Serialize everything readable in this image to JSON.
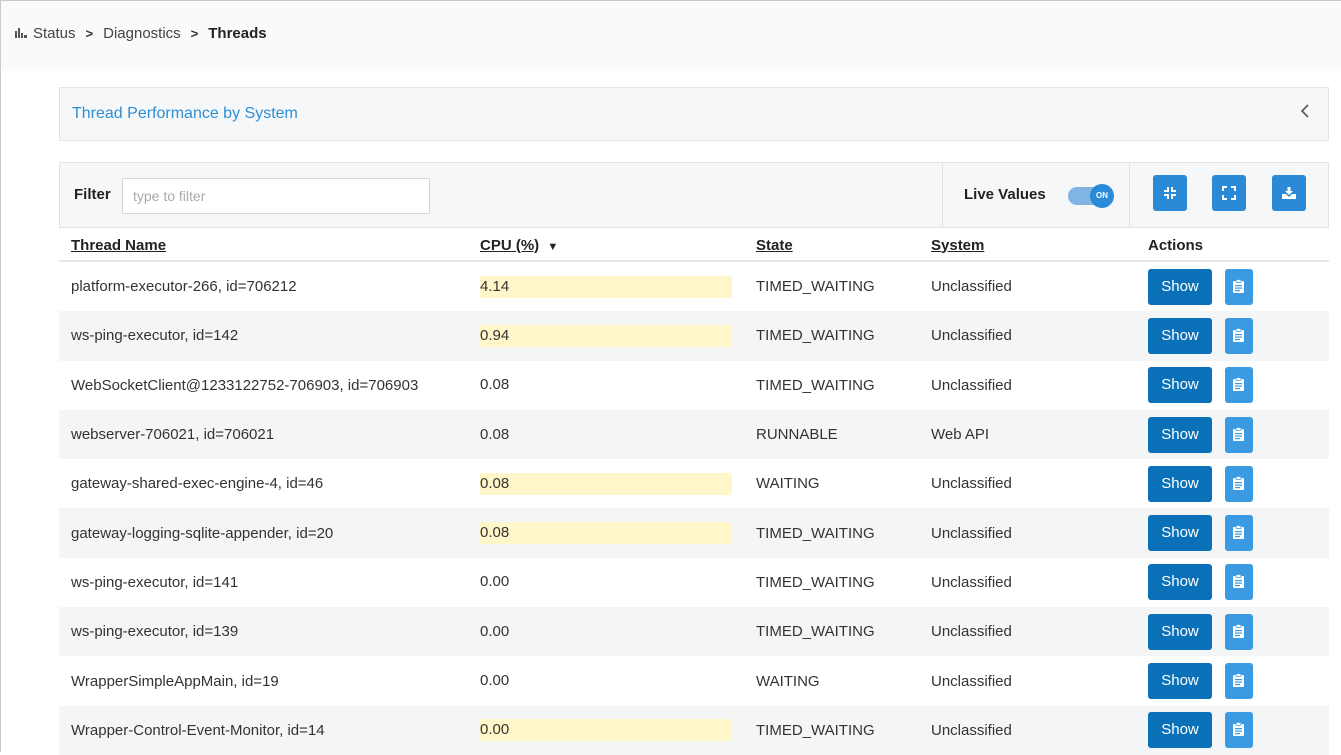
{
  "breadcrumb": {
    "items": [
      "Status",
      "Diagnostics"
    ],
    "current": "Threads",
    "separator": ">"
  },
  "panel": {
    "title": "Thread Performance by System",
    "collapse_icon": "chevron-left-icon"
  },
  "toolbar": {
    "filter_label": "Filter",
    "filter_placeholder": "type to filter",
    "filter_value": "",
    "live_values_label": "Live Values",
    "live_toggle_text": "ON",
    "live_values_on": true,
    "buttons": [
      "collapse-icon",
      "expand-icon",
      "download-icon"
    ]
  },
  "table": {
    "columns": {
      "thread_name": "Thread Name",
      "cpu": "CPU (%)",
      "state": "State",
      "system": "System",
      "actions": "Actions"
    },
    "sort_indicator": "▼",
    "show_label": "Show",
    "rows": [
      {
        "name": "platform-executor-266, id=706212",
        "cpu": "4.14",
        "highlight": true,
        "state": "TIMED_WAITING",
        "system": "Unclassified"
      },
      {
        "name": "ws-ping-executor, id=142",
        "cpu": "0.94",
        "highlight": true,
        "state": "TIMED_WAITING",
        "system": "Unclassified"
      },
      {
        "name": "WebSocketClient@1233122752-706903, id=706903",
        "cpu": "0.08",
        "highlight": false,
        "state": "TIMED_WAITING",
        "system": "Unclassified"
      },
      {
        "name": "webserver-706021, id=706021",
        "cpu": "0.08",
        "highlight": false,
        "state": "RUNNABLE",
        "system": "Web API"
      },
      {
        "name": "gateway-shared-exec-engine-4, id=46",
        "cpu": "0.08",
        "highlight": true,
        "state": "WAITING",
        "system": "Unclassified"
      },
      {
        "name": "gateway-logging-sqlite-appender, id=20",
        "cpu": "0.08",
        "highlight": true,
        "state": "TIMED_WAITING",
        "system": "Unclassified"
      },
      {
        "name": "ws-ping-executor, id=141",
        "cpu": "0.00",
        "highlight": false,
        "state": "TIMED_WAITING",
        "system": "Unclassified"
      },
      {
        "name": "ws-ping-executor, id=139",
        "cpu": "0.00",
        "highlight": false,
        "state": "TIMED_WAITING",
        "system": "Unclassified"
      },
      {
        "name": "WrapperSimpleAppMain, id=19",
        "cpu": "0.00",
        "highlight": false,
        "state": "WAITING",
        "system": "Unclassified"
      },
      {
        "name": "Wrapper-Control-Event-Monitor, id=14",
        "cpu": "0.00",
        "highlight": true,
        "state": "TIMED_WAITING",
        "system": "Unclassified"
      }
    ]
  },
  "colors": {
    "accent": "#2a8ad8",
    "show_button": "#0a70b8",
    "cpu_highlight": "#fff7c9",
    "title_link": "#2d8fd5"
  }
}
